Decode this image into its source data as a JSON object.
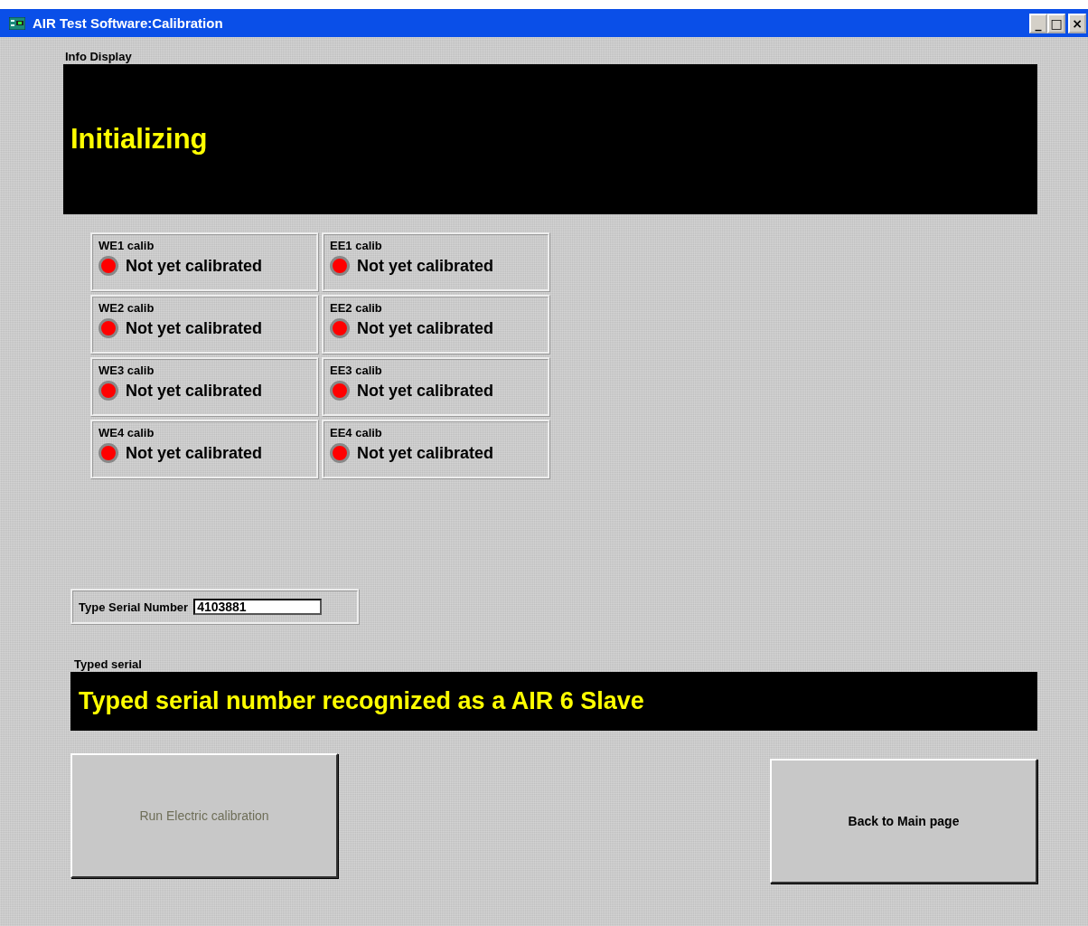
{
  "window": {
    "title": "AIR Test Software:Calibration",
    "controls": [
      "_",
      "□",
      "×"
    ]
  },
  "info_display": {
    "label": "Info Display",
    "message": "Initializing"
  },
  "calibrations": [
    [
      {
        "label": "WE1 calib",
        "status": "Not yet calibrated",
        "calibrated": false
      },
      {
        "label": "WE2 calib",
        "status": "Not yet calibrated",
        "calibrated": false
      },
      {
        "label": "WE3 calib",
        "status": "Not yet calibrated",
        "calibrated": false
      },
      {
        "label": "WE4 calib",
        "status": "Not yet calibrated",
        "calibrated": false
      }
    ],
    [
      {
        "label": "EE1 calib",
        "status": "Not yet calibrated",
        "calibrated": false
      },
      {
        "label": "EE2 calib",
        "status": "Not yet calibrated",
        "calibrated": false
      },
      {
        "label": "EE3 calib",
        "status": "Not yet calibrated",
        "calibrated": false
      },
      {
        "label": "EE4 calib",
        "status": "Not yet calibrated",
        "calibrated": false
      }
    ]
  ],
  "serial": {
    "label": "Type Serial Number",
    "value": "4103881"
  },
  "typed_serial": {
    "label": "Typed serial",
    "message": "Typed serial number recognized as a AIR 6 Slave"
  },
  "buttons": [
    {
      "label": "Run Electric calibration",
      "disabled": true
    },
    {
      "label": "Back to Main page",
      "disabled": false
    }
  ]
}
